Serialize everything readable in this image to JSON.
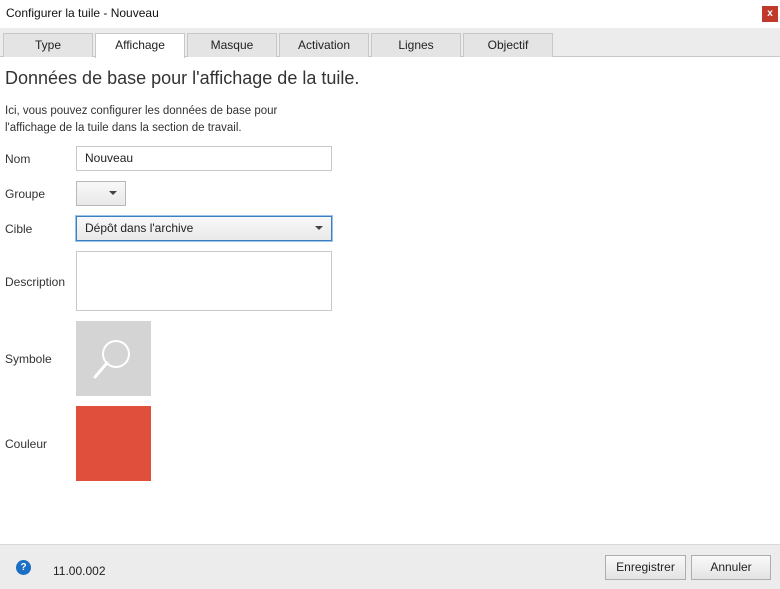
{
  "window": {
    "title": "Configurer la tuile - Nouveau",
    "close_label": "x"
  },
  "tabs": [
    {
      "label": "Type"
    },
    {
      "label": "Affichage",
      "active": true
    },
    {
      "label": "Masque"
    },
    {
      "label": "Activation"
    },
    {
      "label": "Lignes"
    },
    {
      "label": "Objectif"
    }
  ],
  "main": {
    "heading": "Données de base pour l'affichage de la tuile.",
    "intro": "Ici, vous pouvez configurer les données de base pour l'affichage de la tuile dans la section de travail."
  },
  "form": {
    "name_label": "Nom",
    "name_value": "Nouveau",
    "group_label": "Groupe",
    "group_value": "",
    "target_label": "Cible",
    "target_value": "Dépôt dans l'archive",
    "description_label": "Description",
    "description_value": "",
    "symbol_label": "Symbole",
    "symbol_icon": "search-icon",
    "color_label": "Couleur",
    "color_value": "#e04e3c"
  },
  "footer": {
    "help_glyph": "?",
    "version": "11.00.002",
    "save_label": "Enregistrer",
    "cancel_label": "Annuler"
  }
}
